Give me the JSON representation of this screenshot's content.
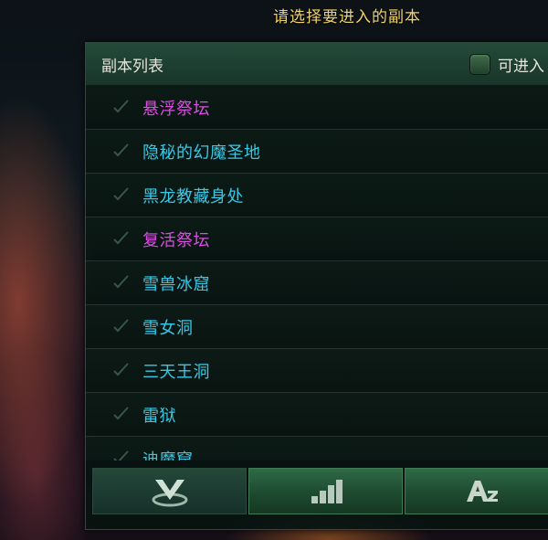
{
  "prompt": "请选择要进入的副本",
  "panel": {
    "title": "副本列表",
    "enterable_filter": {
      "label": "可进入",
      "checked": false
    }
  },
  "dungeons": [
    {
      "name": "悬浮祭坛",
      "color": "#d94ee0"
    },
    {
      "name": "隐秘的幻魔圣地",
      "color": "#37c8e6"
    },
    {
      "name": "黑龙教藏身处",
      "color": "#37c8e6"
    },
    {
      "name": "复活祭坛",
      "color": "#d94ee0"
    },
    {
      "name": "雪兽冰窟",
      "color": "#37c8e6"
    },
    {
      "name": "雪女洞",
      "color": "#37c8e6"
    },
    {
      "name": "三天王洞",
      "color": "#37c8e6"
    },
    {
      "name": "雷狱",
      "color": "#37c8e6"
    },
    {
      "name": "迪魔窟",
      "color": "#37c8e6"
    }
  ],
  "sort_buttons": [
    {
      "icon": "location-pin-icon",
      "active": true
    },
    {
      "icon": "level-bars-icon",
      "active": false
    },
    {
      "icon": "alphabetical-sort-icon",
      "active": false
    }
  ]
}
